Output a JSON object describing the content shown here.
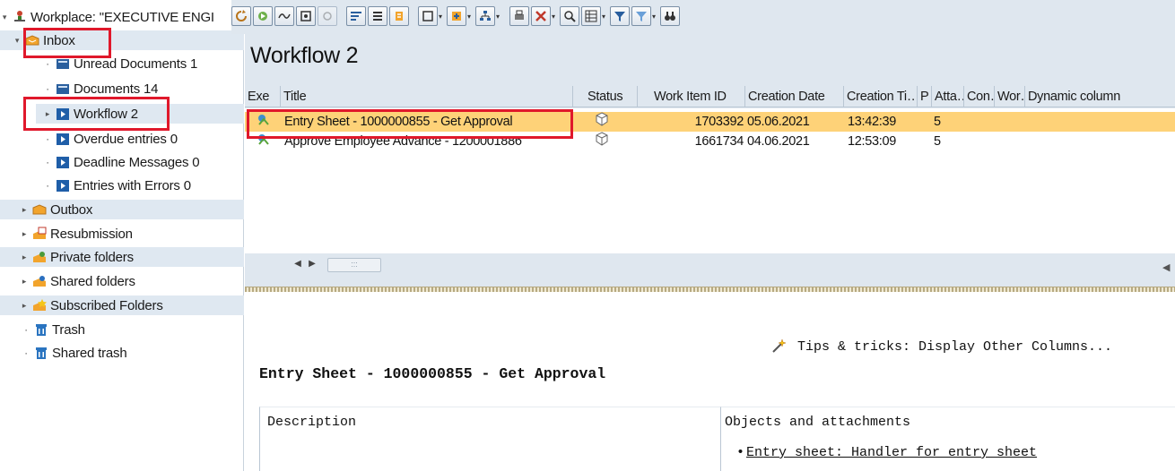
{
  "tree": {
    "root": "Workplace: \"EXECUTIVE ENGI",
    "items": [
      {
        "label": "Inbox",
        "level": 0,
        "expanded": true,
        "icon": "inbox-icon"
      },
      {
        "label": "Unread Documents 1",
        "level": 1,
        "icon": "document-icon"
      },
      {
        "label": "Documents 14",
        "level": 1,
        "icon": "document-icon"
      },
      {
        "label": "Workflow 2",
        "level": 1,
        "icon": "workflow-icon",
        "selected": true
      },
      {
        "label": "Overdue entries 0",
        "level": 1,
        "icon": "workflow-icon"
      },
      {
        "label": "Deadline Messages 0",
        "level": 1,
        "icon": "workflow-icon"
      },
      {
        "label": "Entries with Errors 0",
        "level": 1,
        "icon": "workflow-icon"
      },
      {
        "label": "Outbox",
        "level": 0,
        "icon": "outbox-icon"
      },
      {
        "label": "Resubmission",
        "level": 0,
        "icon": "resubmission-icon"
      },
      {
        "label": "Private folders",
        "level": 0,
        "icon": "private-folders-icon"
      },
      {
        "label": "Shared folders",
        "level": 0,
        "icon": "shared-folders-icon"
      },
      {
        "label": "Subscribed Folders",
        "level": 0,
        "icon": "subscribed-folders-icon"
      },
      {
        "label": "Trash",
        "level": 0,
        "icon": "trash-icon"
      },
      {
        "label": "Shared trash",
        "level": 0,
        "icon": "trash-icon"
      }
    ]
  },
  "main": {
    "title": "Workflow 2",
    "columns": [
      "Exe",
      "Title",
      "Status",
      "Work Item ID",
      "Creation Date",
      "Creation Ti…",
      "P",
      "Atta…",
      "Con…",
      "Wor…",
      "Dynamic column"
    ],
    "rows": [
      {
        "title": "Entry Sheet - 1000000855 - Get Approval",
        "work_item_id": "1703392",
        "creation_date": "05.06.2021",
        "creation_time": "13:42:39",
        "priority": "5"
      },
      {
        "title": "Approve Employee Advance - 1200001886",
        "work_item_id": "1661734",
        "creation_date": "04.06.2021",
        "creation_time": "12:53:09",
        "priority": "5"
      }
    ]
  },
  "detail": {
    "tips": "Tips & tricks:  Display Other Columns...",
    "title": "Entry Sheet - 1000000855 - Get Approval",
    "description_label": "Description",
    "objects_label": "Objects and attachments",
    "object_link": "Entry sheet: Handler for entry sheet"
  },
  "colors": {
    "selected_row": "#fed278",
    "panel_bg": "#dfe7ef",
    "highlight_box": "#e0182b"
  }
}
